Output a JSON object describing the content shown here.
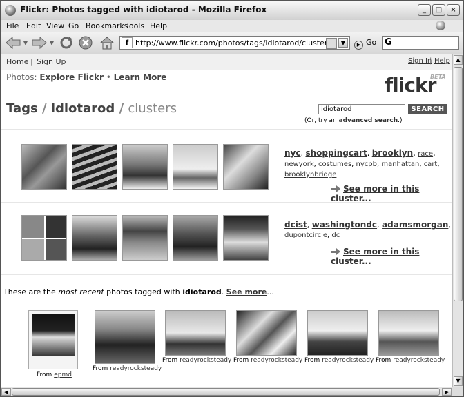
{
  "window": {
    "title": "Flickr: Photos tagged with idiotarod - Mozilla Firefox",
    "minimize": "_",
    "maximize": "□",
    "close": "×"
  },
  "menu": [
    "File",
    "Edit",
    "View",
    "Go",
    "Bookmarks",
    "Tools",
    "Help"
  ],
  "toolbar": {
    "url": "http://www.flickr.com/photos/tags/idiotarod/clusters/",
    "favicon": "f",
    "go_label": "Go",
    "search_engine": "G"
  },
  "topnav": {
    "home": "Home",
    "sep": "|",
    "signup": "Sign Up",
    "signin": "Sign In",
    "help": "Help"
  },
  "photos_nav": {
    "label": "Photos:",
    "explore": "Explore Flickr",
    "bullet": "•",
    "learn": "Learn More"
  },
  "logo": {
    "text": "flickr",
    "beta": "BETA"
  },
  "heading": {
    "tags": "Tags",
    "sep1": " / ",
    "tag": "idiotarod",
    "sep2": " / ",
    "clusters": "clusters"
  },
  "search": {
    "value": "idiotarod",
    "button": "SEARCH",
    "hint_prefix": "(Or, try an ",
    "hint_link": "advanced search",
    "hint_suffix": ".)"
  },
  "clusters": [
    {
      "main_tags": [
        "nyc",
        "shoppingcart",
        "brooklyn"
      ],
      "row1_small": [
        "race"
      ],
      "row2": [
        "newyork",
        "costumes",
        "nycpb",
        "manhattan",
        "cart"
      ],
      "row3": [
        "brooklynbridge"
      ],
      "see_more": "See more in this cluster..."
    },
    {
      "main_tags": [
        "dcist",
        "washingtondc",
        "adamsmorgan"
      ],
      "row2": [
        "dupontcircle",
        "dc"
      ],
      "see_more": "See more in this cluster..."
    }
  ],
  "recent": {
    "prefix": "These are the ",
    "emph": "most recent",
    "middle": " photos tagged with ",
    "tag": "idiotarod",
    "dot": ". ",
    "see_more": "See more",
    "ellipsis": "...",
    "from": "From",
    "captions": [
      "epmd",
      "readyrocksteady",
      "readyrocksteady",
      "readyrocksteady",
      "readyrocksteady",
      "readyrocksteady"
    ]
  }
}
